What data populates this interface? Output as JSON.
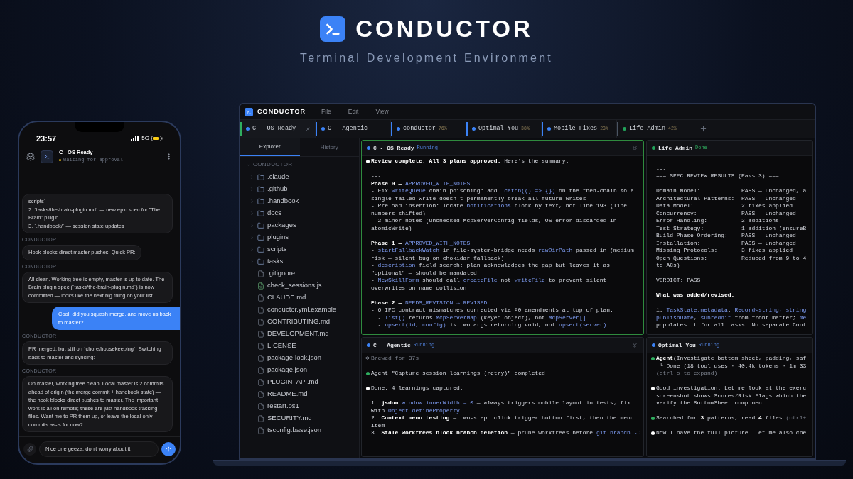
{
  "header": {
    "title": "CONDUCTOR",
    "subtitle": "Terminal Development Environment"
  },
  "phone": {
    "time": "23:57",
    "network": "5G",
    "chat_title": "C - OS Ready",
    "chat_status": "Waiting for approval",
    "messages": [
      {
        "kind": "assistant",
        "text": "scripts`\n2. `tasks/the-brain-plugin.md` — new epic spec for \"The Brain\" plugin\n3. `.handbook/` — session state updates"
      },
      {
        "kind": "assistant",
        "sender": "CONDUCTOR",
        "text": "Hook blocks direct master pushes. Quick PR:"
      },
      {
        "kind": "assistant",
        "sender": "CONDUCTOR",
        "text": "All clean. Working tree is empty, master is up to date. The Brain plugin spec (`tasks/the-brain-plugin.md`) is now committed — looks like the next big thing on your list."
      },
      {
        "kind": "user",
        "text": "Cool, did you squash merge, and move us back to master?"
      },
      {
        "kind": "assistant",
        "sender": "CONDUCTOR",
        "text": "PR merged, but still on `chore/housekeeping`. Switching back to master and syncing:"
      },
      {
        "kind": "assistant",
        "sender": "CONDUCTOR",
        "text": "On master, working tree clean. Local master is 2 commits ahead of origin (the merge commit + handbook state) — the hook blocks direct pushes to master. The important work is all on remote; these are just handbook tracking files. Want me to PR them up, or leave the local-only commits as-is for now?"
      }
    ],
    "input": {
      "value": "Nice one geeza, don't worry about it"
    }
  },
  "app": {
    "name": "CONDUCTOR",
    "menu": [
      "File",
      "Edit",
      "View"
    ],
    "tabs": [
      {
        "label": "C - OS Ready",
        "kind": "running",
        "selected": true
      },
      {
        "label": "C - Agentic",
        "kind": "running",
        "selected": false
      },
      {
        "label": "conductor",
        "percent": "76%",
        "kind": "running",
        "selected": false
      },
      {
        "label": "Optimal You",
        "percent": "38%",
        "kind": "running",
        "selected": false
      },
      {
        "label": "Mobile Fixes",
        "percent": "23%",
        "kind": "running",
        "selected": false
      },
      {
        "label": "Life Admin",
        "percent": "42%",
        "kind": "done",
        "selected": false
      }
    ],
    "sidebar": {
      "tabs": [
        {
          "label": "Explorer",
          "selected": true
        },
        {
          "label": "History",
          "selected": false
        }
      ],
      "section": "CONDUCTOR",
      "items": [
        {
          "name": ".claude",
          "kind": "folder"
        },
        {
          "name": ".github",
          "kind": "folder"
        },
        {
          "name": ".handbook",
          "kind": "folder"
        },
        {
          "name": "docs",
          "kind": "folder"
        },
        {
          "name": "packages",
          "kind": "folder"
        },
        {
          "name": "plugins",
          "kind": "folder"
        },
        {
          "name": "scripts",
          "kind": "folder"
        },
        {
          "name": "tasks",
          "kind": "folder"
        },
        {
          "name": ".gitignore",
          "kind": "file"
        },
        {
          "name": "check_sessions.js",
          "kind": "script"
        },
        {
          "name": "CLAUDE.md",
          "kind": "file"
        },
        {
          "name": "conductor.yml.example",
          "kind": "file"
        },
        {
          "name": "CONTRIBUTING.md",
          "kind": "file"
        },
        {
          "name": "DEVELOPMENT.md",
          "kind": "file"
        },
        {
          "name": "LICENSE",
          "kind": "file"
        },
        {
          "name": "package-lock.json",
          "kind": "file"
        },
        {
          "name": "package.json",
          "kind": "file"
        },
        {
          "name": "PLUGIN_API.md",
          "kind": "file"
        },
        {
          "name": "README.md",
          "kind": "file"
        },
        {
          "name": "restart.ps1",
          "kind": "file"
        },
        {
          "name": "SECURITY.md",
          "kind": "file"
        },
        {
          "name": "tsconfig.base.json",
          "kind": "file"
        }
      ]
    },
    "panels": [
      {
        "title": "C - OS Ready",
        "kind": "running",
        "status": "Running",
        "focused": true,
        "lines": [
          {
            "kind": "result",
            "segs": [
              {
                "t": "Review complete. All 3 plans approved.",
                "kind": "bold"
              },
              {
                "t": " Here's the summary:",
                "kind": "plain"
              }
            ]
          },
          {
            "kind": "text",
            "blank_before": true,
            "segs": [
              {
                "t": "---",
                "kind": "plain"
              }
            ]
          },
          {
            "kind": "text",
            "segs": [
              {
                "t": "Phase 0 — ",
                "kind": "bold"
              },
              {
                "t": "APPROVED_WITH_NOTES",
                "kind": "code"
              }
            ]
          },
          {
            "kind": "text",
            "segs": [
              {
                "t": "- Fix ",
                "kind": "plain"
              },
              {
                "t": "writeQueue",
                "kind": "code"
              },
              {
                "t": " chain poisoning: add ",
                "kind": "plain"
              },
              {
                "t": ".catch(() => {})",
                "kind": "code"
              },
              {
                "t": " on the then-chain so a single failed write doesn't permanently break all future writes",
                "kind": "plain"
              }
            ]
          },
          {
            "kind": "text",
            "segs": [
              {
                "t": "- Preload insertion: locate ",
                "kind": "plain"
              },
              {
                "t": "notifications",
                "kind": "code"
              },
              {
                "t": " block by text, not line 193 (line numbers shifted)",
                "kind": "plain"
              }
            ]
          },
          {
            "kind": "text",
            "segs": [
              {
                "t": "- 2 minor notes (unchecked McpServerConfig fields, OS error discarded in atomicWrite)",
                "kind": "plain"
              }
            ]
          },
          {
            "kind": "text",
            "blank_before": true,
            "segs": [
              {
                "t": "Phase 1 — ",
                "kind": "bold"
              },
              {
                "t": "APPROVED_WITH_NOTES",
                "kind": "code"
              }
            ]
          },
          {
            "kind": "text",
            "segs": [
              {
                "t": "- ",
                "kind": "plain"
              },
              {
                "t": "startFallbackWatch",
                "kind": "code"
              },
              {
                "t": " in file-system-bridge needs ",
                "kind": "plain"
              },
              {
                "t": "rawDirPath",
                "kind": "code"
              },
              {
                "t": " passed in (medium risk — silent bug on chokidar fallback)",
                "kind": "plain"
              }
            ]
          },
          {
            "kind": "text",
            "segs": [
              {
                "t": "- ",
                "kind": "plain"
              },
              {
                "t": "description",
                "kind": "code"
              },
              {
                "t": " field search: plan acknowledges the gap but leaves it as \"optional\" — should be mandated",
                "kind": "plain"
              }
            ]
          },
          {
            "kind": "text",
            "segs": [
              {
                "t": "- ",
                "kind": "plain"
              },
              {
                "t": "NewSkillForm",
                "kind": "code"
              },
              {
                "t": " should call ",
                "kind": "plain"
              },
              {
                "t": "createFile",
                "kind": "code"
              },
              {
                "t": " not ",
                "kind": "plain"
              },
              {
                "t": "writeFile",
                "kind": "code"
              },
              {
                "t": " to prevent silent overwrites on name collision",
                "kind": "plain"
              }
            ]
          },
          {
            "kind": "text",
            "blank_before": true,
            "segs": [
              {
                "t": "Phase 2 — ",
                "kind": "bold"
              },
              {
                "t": "NEEDS_REVISION → REVISED",
                "kind": "code"
              }
            ]
          },
          {
            "kind": "text",
            "segs": [
              {
                "t": "- 6 IPC contract mismatches corrected via §0 amendments at top of plan:",
                "kind": "plain"
              }
            ]
          },
          {
            "kind": "text",
            "segs": [
              {
                "t": "  - ",
                "kind": "plain"
              },
              {
                "t": "list()",
                "kind": "code"
              },
              {
                "t": " returns ",
                "kind": "plain"
              },
              {
                "t": "McpServerMap",
                "kind": "code"
              },
              {
                "t": " (keyed object), not ",
                "kind": "plain"
              },
              {
                "t": "McpServer[]",
                "kind": "code"
              }
            ]
          },
          {
            "kind": "text",
            "segs": [
              {
                "t": "  - ",
                "kind": "plain"
              },
              {
                "t": "upsert(id, config)",
                "kind": "code"
              },
              {
                "t": " is two args returning void, not ",
                "kind": "plain"
              },
              {
                "t": "upsert(server)",
                "kind": "code"
              }
            ]
          }
        ]
      },
      {
        "title": "Life Admin",
        "kind": "done",
        "status": "Done",
        "focused": false,
        "lines": [
          {
            "kind": "text",
            "blank_before": true,
            "segs": [
              {
                "t": "---",
                "kind": "plain"
              }
            ]
          },
          {
            "kind": "text",
            "segs": [
              {
                "t": "=== SPEC REVIEW RESULTS (Pass 3) ===",
                "kind": "plain"
              }
            ]
          },
          {
            "kind": "text",
            "blank_before": true,
            "segs": [
              {
                "t": "Domain Model:            PASS — unchanged, a",
                "kind": "plain"
              }
            ]
          },
          {
            "kind": "text",
            "segs": [
              {
                "t": "Architectural Patterns:  PASS — unchanged",
                "kind": "plain"
              }
            ]
          },
          {
            "kind": "text",
            "segs": [
              {
                "t": "Data Model:              2 fixes applied",
                "kind": "plain"
              }
            ]
          },
          {
            "kind": "text",
            "segs": [
              {
                "t": "Concurrency:             PASS — unchanged",
                "kind": "plain"
              }
            ]
          },
          {
            "kind": "text",
            "segs": [
              {
                "t": "Error Handling:          2 additions",
                "kind": "plain"
              }
            ]
          },
          {
            "kind": "text",
            "segs": [
              {
                "t": "Test Strategy:           1 addition (ensureB",
                "kind": "plain"
              }
            ]
          },
          {
            "kind": "text",
            "segs": [
              {
                "t": "Build Phase Ordering:    PASS — unchanged",
                "kind": "plain"
              }
            ]
          },
          {
            "kind": "text",
            "segs": [
              {
                "t": "Installation:            PASS — unchanged",
                "kind": "plain"
              }
            ]
          },
          {
            "kind": "text",
            "segs": [
              {
                "t": "Missing Protocols:       3 fixes applied",
                "kind": "plain"
              }
            ]
          },
          {
            "kind": "text",
            "segs": [
              {
                "t": "Open Questions:          Reduced from 9 to 4",
                "kind": "plain"
              }
            ]
          },
          {
            "kind": "text",
            "segs": [
              {
                "t": "to ACs)",
                "kind": "plain"
              }
            ]
          },
          {
            "kind": "text",
            "blank_before": true,
            "segs": [
              {
                "t": "VERDICT: PASS",
                "kind": "plain"
              }
            ]
          },
          {
            "kind": "text",
            "blank_before": true,
            "segs": [
              {
                "t": "What was added/revised:",
                "kind": "bold"
              }
            ]
          },
          {
            "kind": "text",
            "blank_before": true,
            "segs": [
              {
                "t": "1. ",
                "kind": "plain"
              },
              {
                "t": "TaskState.metadata",
                "kind": "code"
              },
              {
                "t": ": ",
                "kind": "plain"
              },
              {
                "t": "Record<string, string",
                "kind": "code"
              }
            ]
          },
          {
            "kind": "text",
            "segs": [
              {
                "t": "publishDate",
                "kind": "code"
              },
              {
                "t": ", ",
                "kind": "plain"
              },
              {
                "t": "subreddit",
                "kind": "code"
              },
              {
                "t": " from front matter; ",
                "kind": "plain"
              },
              {
                "t": "me",
                "kind": "code"
              }
            ]
          },
          {
            "kind": "text",
            "segs": [
              {
                "t": "populates it for all tasks. No separate Cont",
                "kind": "plain"
              }
            ]
          }
        ]
      },
      {
        "title": "C - Agentic",
        "kind": "running",
        "status": "Running",
        "focused": false,
        "lines": [
          {
            "kind": "text",
            "glyph": "✻",
            "segs": [
              {
                "t": "Brewed for 37s",
                "kind": "dim"
              }
            ]
          },
          {
            "kind": "tool",
            "blank_before": true,
            "segs": [
              {
                "t": "Agent \"Capture session learnings (retry)\" completed",
                "kind": "plain"
              }
            ]
          },
          {
            "kind": "result",
            "blank_before": true,
            "segs": [
              {
                "t": "Done. 4 learnings captured:",
                "kind": "plain"
              }
            ]
          },
          {
            "kind": "text",
            "blank_before": true,
            "segs": [
              {
                "t": "1. ",
                "kind": "plain"
              },
              {
                "t": "jsdom ",
                "kind": "bold"
              },
              {
                "t": "window.innerWidth = 0",
                "kind": "code"
              },
              {
                "t": " — always triggers mobile layout in tests; fix with ",
                "kind": "plain"
              },
              {
                "t": "Object.defineProperty",
                "kind": "code"
              }
            ]
          },
          {
            "kind": "text",
            "segs": [
              {
                "t": "2. ",
                "kind": "plain"
              },
              {
                "t": "Context menu testing",
                "kind": "bold"
              },
              {
                "t": " — two-step: click trigger button first, then the menu item",
                "kind": "plain"
              }
            ]
          },
          {
            "kind": "text",
            "segs": [
              {
                "t": "3. ",
                "kind": "plain"
              },
              {
                "t": "Stale worktrees block branch deletion",
                "kind": "bold"
              },
              {
                "t": " — prune worktrees before ",
                "kind": "plain"
              },
              {
                "t": "git branch -D",
                "kind": "code"
              }
            ]
          }
        ]
      },
      {
        "title": "Optimal You",
        "kind": "running",
        "status": "Running",
        "focused": false,
        "lines": [
          {
            "kind": "tool",
            "segs": [
              {
                "t": "Agent",
                "kind": "bold"
              },
              {
                "t": "(Investigate bottom sheet, padding, saf",
                "kind": "plain"
              }
            ]
          },
          {
            "kind": "text",
            "segs": [
              {
                "t": " └ Done (18 tool uses · 40.4k tokens · 1m 33",
                "kind": "plain"
              }
            ]
          },
          {
            "kind": "text",
            "segs": [
              {
                "t": "(ctrl+o to expand)",
                "kind": "dim"
              }
            ]
          },
          {
            "kind": "result",
            "blank_before": true,
            "segs": [
              {
                "t": "Good investigation. Let me look at the exerc",
                "kind": "plain"
              }
            ]
          },
          {
            "kind": "text",
            "segs": [
              {
                "t": "screenshot shows Scores/Risk Flags which the",
                "kind": "plain"
              }
            ]
          },
          {
            "kind": "text",
            "segs": [
              {
                "t": "verify the BottomSheet component:",
                "kind": "plain"
              }
            ]
          },
          {
            "kind": "tool",
            "blank_before": true,
            "segs": [
              {
                "t": "Searched for ",
                "kind": "plain"
              },
              {
                "t": "3",
                "kind": "bold"
              },
              {
                "t": " patterns, read ",
                "kind": "plain"
              },
              {
                "t": "4",
                "kind": "bold"
              },
              {
                "t": " files ",
                "kind": "plain"
              },
              {
                "t": "(ctrl+",
                "kind": "dim"
              }
            ]
          },
          {
            "kind": "result",
            "blank_before": true,
            "segs": [
              {
                "t": "Now I have the full picture. Let me also che",
                "kind": "plain"
              }
            ]
          }
        ]
      }
    ]
  }
}
